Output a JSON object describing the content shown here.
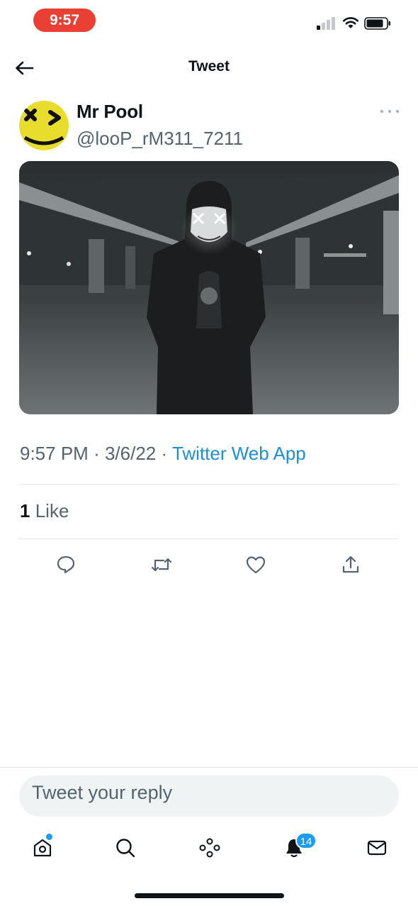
{
  "status_bar": {
    "time": "9:57"
  },
  "header": {
    "title": "Tweet"
  },
  "tweet": {
    "author_name": "Mr Pool",
    "author_handle": "@looP_rM311_7211",
    "time": "9:57 PM",
    "separator": "·",
    "date": "3/6/22",
    "source": "Twitter Web App",
    "like_count": "1",
    "like_label": "Like"
  },
  "reply": {
    "placeholder": "Tweet your reply"
  },
  "tabbar": {
    "notifications_badge": "14"
  },
  "icons": [
    "back-arrow-icon",
    "more-icon",
    "reply-icon",
    "retweet-icon",
    "like-icon",
    "share-icon",
    "home-icon",
    "search-icon",
    "spaces-icon",
    "notifications-icon",
    "messages-icon"
  ],
  "colors": {
    "accent": "#1d9bf0",
    "status_pill": "#ea3f33",
    "secondary_text": "#536471"
  }
}
